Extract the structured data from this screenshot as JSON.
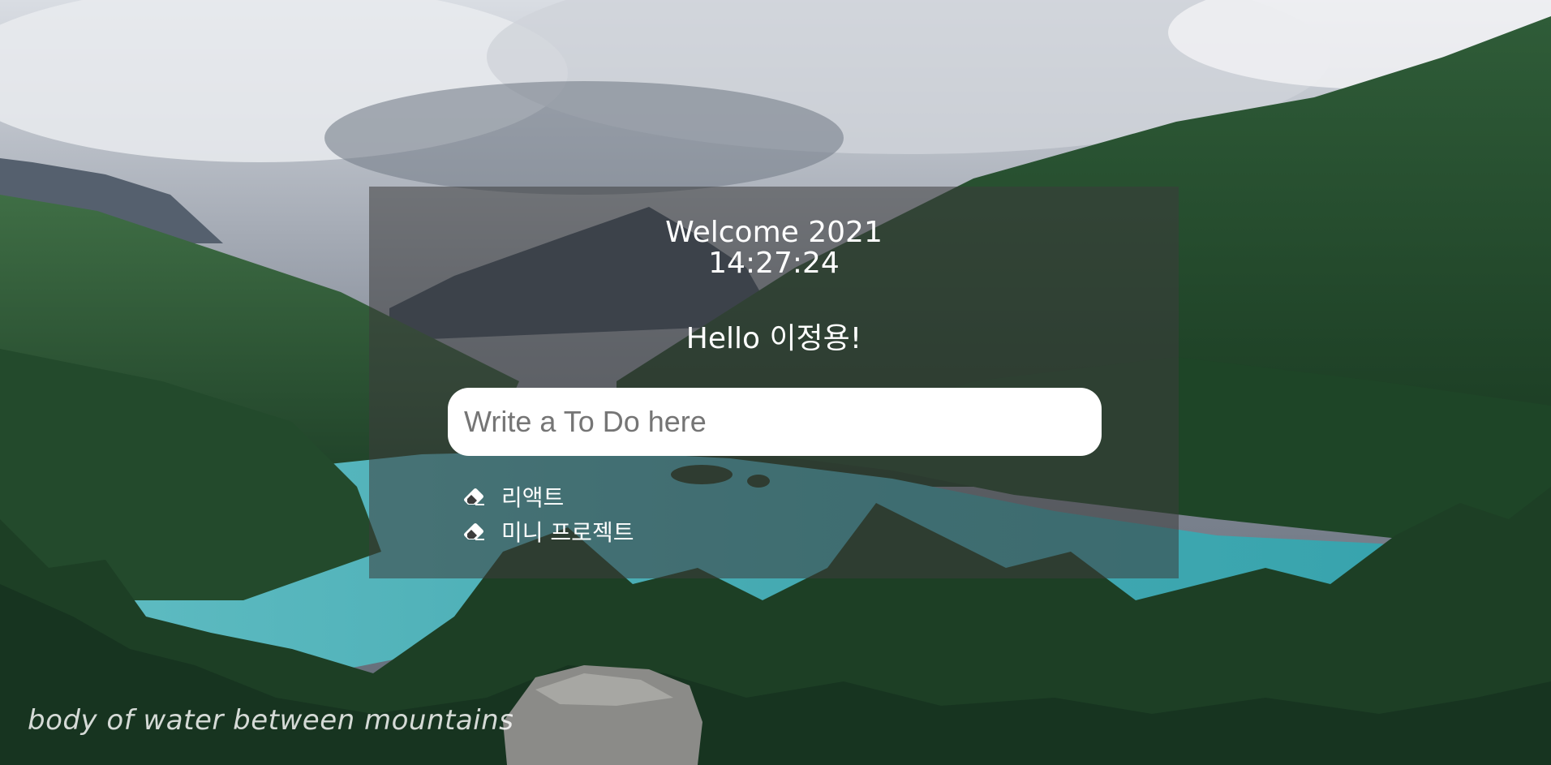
{
  "header": {
    "welcome": "Welcome 2021",
    "clock": "14:27:24"
  },
  "greeting": "Hello 이정용!",
  "todo_form": {
    "placeholder": "Write a To Do here",
    "value": ""
  },
  "todos": [
    {
      "icon": "eraser-icon",
      "text": "리액트"
    },
    {
      "icon": "eraser-icon",
      "text": "미니 프로젝트"
    }
  ],
  "background": {
    "caption": "body of water between mountains"
  },
  "colors": {
    "panel": "#3c3c3c",
    "text": "#ffffff",
    "lake": "#4fb3b8",
    "forest": "#1f4a2c"
  }
}
